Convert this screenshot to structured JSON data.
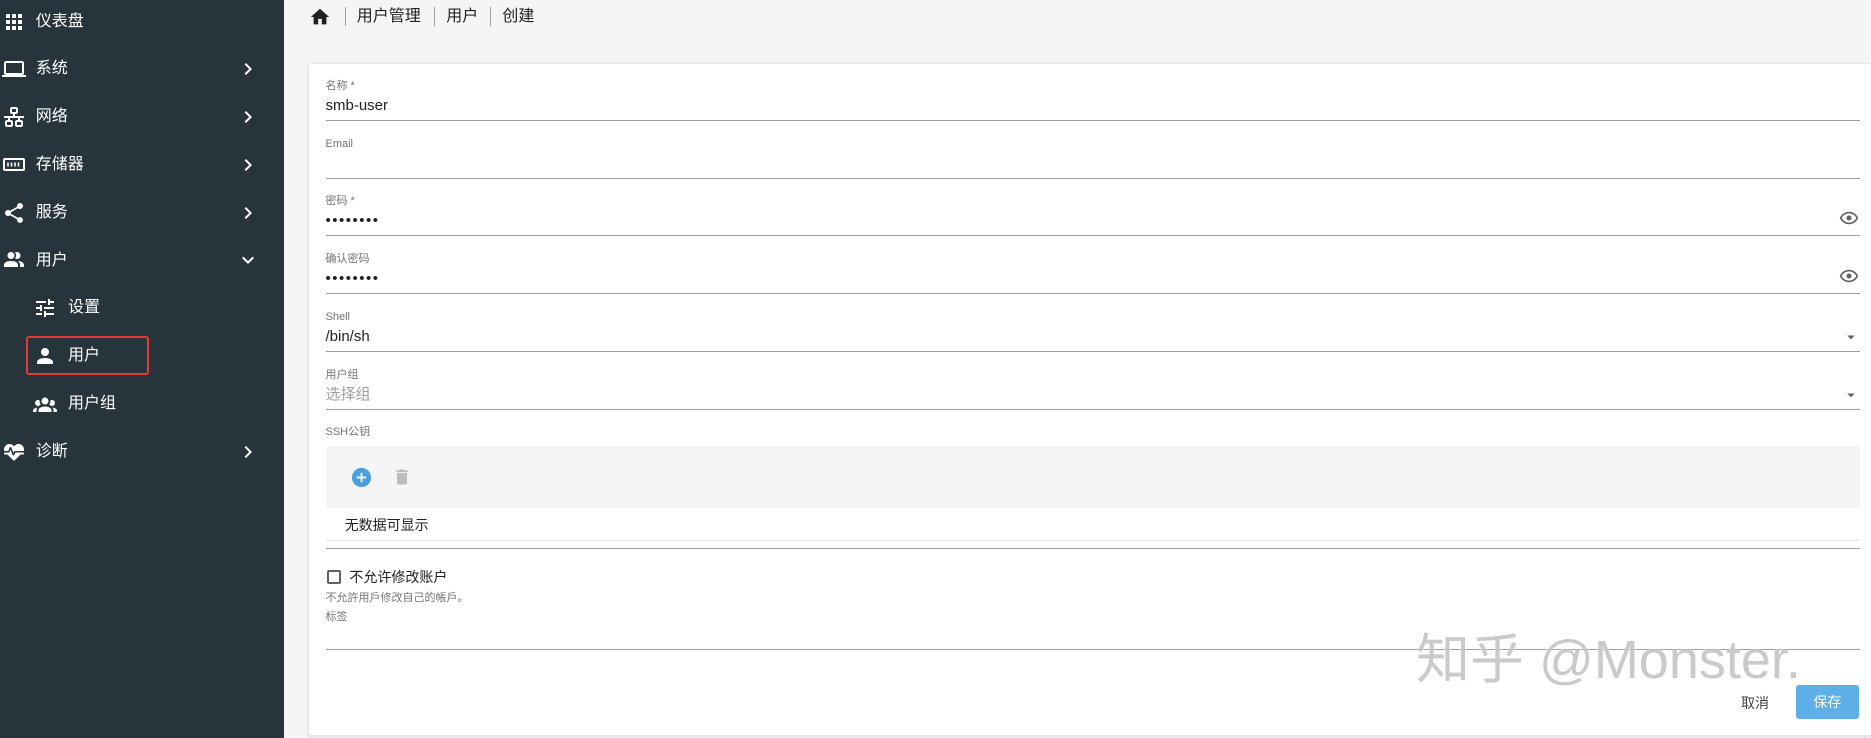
{
  "colors": {
    "sidebar_bg": "#28343b",
    "save_button": "#5eaee8",
    "highlight_border": "#e53935",
    "add_icon": "#4a9fde"
  },
  "sidebar": {
    "items": [
      {
        "label": "仪表盘",
        "icon": "apps-icon"
      },
      {
        "label": "系统",
        "icon": "laptop-icon",
        "expandable": true
      },
      {
        "label": "网络",
        "icon": "network-icon",
        "expandable": true
      },
      {
        "label": "存储器",
        "icon": "memory-icon",
        "expandable": true
      },
      {
        "label": "服务",
        "icon": "share-icon",
        "expandable": true
      },
      {
        "label": "用户",
        "icon": "account-multiple-icon",
        "expanded": true,
        "children": [
          {
            "label": "设置",
            "icon": "tune-icon"
          },
          {
            "label": "用户",
            "icon": "account-icon",
            "highlighted": true
          },
          {
            "label": "用户组",
            "icon": "account-group-icon"
          }
        ]
      },
      {
        "label": "诊断",
        "icon": "heart-pulse-icon",
        "expandable": true
      }
    ]
  },
  "breadcrumb": {
    "home_icon": "home-icon",
    "items": [
      "用户管理",
      "用户",
      "创建"
    ]
  },
  "form": {
    "name": {
      "label": "名称 *",
      "value": "smb-user"
    },
    "email": {
      "label": "Email",
      "value": ""
    },
    "password": {
      "label": "密码 *",
      "value": "••••••••",
      "icon": "eye-icon"
    },
    "confirm_password": {
      "label": "确认密码",
      "value": "••••••••",
      "icon": "eye-icon"
    },
    "shell": {
      "label": "Shell",
      "value": "/bin/sh"
    },
    "groups": {
      "label": "用户组",
      "placeholder": "选择组"
    },
    "ssh_keys": {
      "label": "SSH公钥",
      "empty_text": "无数据可显示",
      "add_icon": "plus-circle-icon",
      "delete_icon": "trash-icon"
    },
    "disallow_edit": {
      "label": "不允许修改账户",
      "hint": "不允許用戶修改自己的帳戶。",
      "checked": false
    },
    "tags": {
      "label": "标签",
      "value": ""
    }
  },
  "actions": {
    "cancel": "取消",
    "save": "保存"
  },
  "watermark": {
    "text": "知乎 @Monster."
  }
}
